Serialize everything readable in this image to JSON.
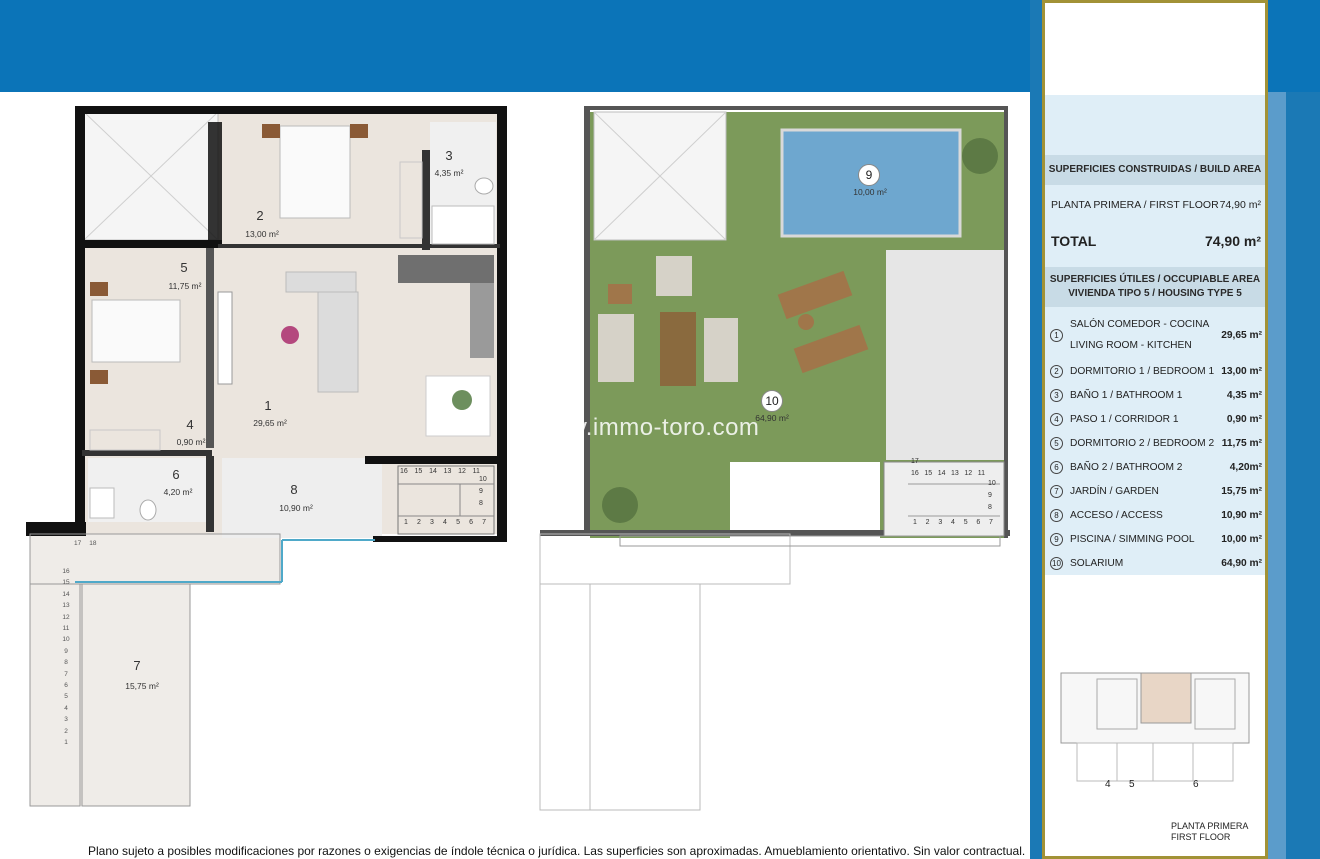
{
  "header": {
    "brand_color": "#0b74b8"
  },
  "floorplan_left": {
    "rooms": [
      {
        "num": "1",
        "area": "29,65 m²"
      },
      {
        "num": "2",
        "area": "13,00 m²"
      },
      {
        "num": "3",
        "area": "4,35 m²"
      },
      {
        "num": "4",
        "area": "0,90 m²"
      },
      {
        "num": "5",
        "area": "11,75 m²"
      },
      {
        "num": "6",
        "area": "4,20 m²"
      },
      {
        "num": "7",
        "area": "15,75 m²"
      },
      {
        "num": "8",
        "area": "10,90 m²"
      }
    ],
    "stairs_top": [
      "16",
      "15",
      "14",
      "13",
      "12",
      "11"
    ],
    "stairs_bottom": [
      "1",
      "2",
      "3",
      "4",
      "5",
      "6",
      "7"
    ],
    "stairs_right": [
      "10",
      "9",
      "8"
    ],
    "stairs_side": [
      "16",
      "15",
      "14",
      "13",
      "12",
      "11",
      "10",
      "9",
      "8",
      "7",
      "6",
      "5",
      "4",
      "3",
      "2",
      "1"
    ],
    "stairs_side_top": [
      "17",
      "18"
    ]
  },
  "floorplan_right": {
    "rooms": [
      {
        "num": "9",
        "area": "10,00 m²"
      },
      {
        "num": "10",
        "area": "64,90 m²"
      }
    ],
    "stairs_top": [
      "16",
      "15",
      "14",
      "13",
      "12",
      "11"
    ],
    "stairs_bottom": [
      "1",
      "2",
      "3",
      "4",
      "5",
      "6",
      "7"
    ],
    "stairs_right": [
      "10",
      "9",
      "8"
    ],
    "stairs_17": "17",
    "watermark": "v.immo-toro.com"
  },
  "legend": {
    "build_area_heading": "SUPERFICIES CONSTRUIDAS / BUILD AREA",
    "first_floor_label": "PLANTA PRIMERA / FIRST FLOOR",
    "first_floor_value": "74,90 m²",
    "total_label": "TOTAL",
    "total_value": "74,90 m²",
    "useful_heading_1": "SUPERFICIES ÚTILES / OCCUPIABLE AREA",
    "useful_heading_2": "VIVIENDA TIPO 5 / HOUSING TYPE 5",
    "areas": [
      {
        "num": "1",
        "label_1": "SALÓN COMEDOR - COCINA",
        "label_2": "LIVING ROOM - KITCHEN",
        "value": "29,65 m²"
      },
      {
        "num": "2",
        "label": "DORMITORIO 1 / BEDROOM 1",
        "value": "13,00 m²"
      },
      {
        "num": "3",
        "label": "BAÑO 1 / BATHROOM 1",
        "value": "4,35 m²"
      },
      {
        "num": "4",
        "label": "PASO 1 / CORRIDOR 1",
        "value": "0,90 m²"
      },
      {
        "num": "5",
        "label": "DORMITORIO 2 / BEDROOM 2",
        "value": "11,75 m²"
      },
      {
        "num": "6",
        "label": "BAÑO 2 / BATHROOM 2",
        "value": "4,20m²"
      },
      {
        "num": "7",
        "label": "JARDÍN / GARDEN",
        "value": "15,75 m²"
      },
      {
        "num": "8",
        "label": "ACCESO / ACCESS",
        "value": "10,90 m²"
      },
      {
        "num": "9",
        "label": "PISCINA / SIMMING POOL",
        "value": "10,00 m²"
      },
      {
        "num": "10",
        "label": "SOLARIUM",
        "value": "64,90 m²"
      }
    ],
    "key_labels": [
      "4",
      "5",
      "6"
    ],
    "floor_caption_1": "PLANTA PRIMERA",
    "floor_caption_2": "FIRST FLOOR",
    "panel_border_color": "#a29236"
  },
  "footer": {
    "disclaimer": "Plano sujeto a posibles modificaciones por razones o exigencias de índole técnica o jurídica. Las superficies son aproximadas. Amueblamiento orientativo. Sin valor contractual."
  }
}
